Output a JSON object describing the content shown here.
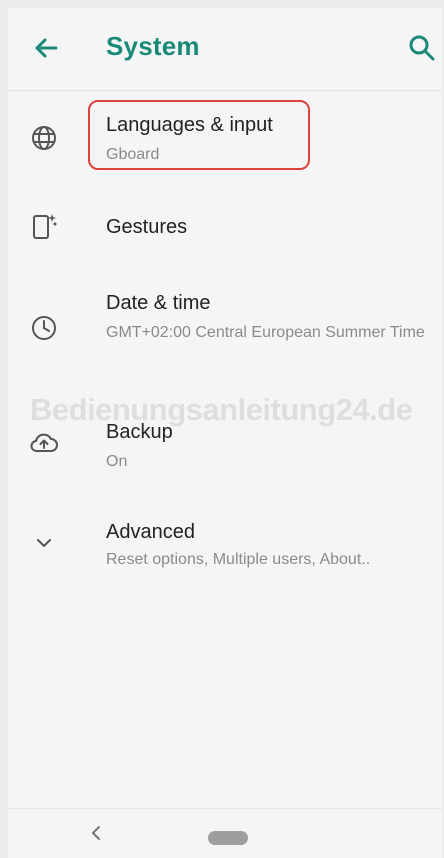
{
  "header": {
    "title": "System",
    "back_icon": "arrow-left-icon",
    "search_icon": "search-icon"
  },
  "items": [
    {
      "label": "Languages & input",
      "sub": "Gboard",
      "icon": "globe-icon",
      "highlighted": true
    },
    {
      "label": "Gestures",
      "sub": "",
      "icon": "phone-gesture-icon"
    },
    {
      "label": "Date & time",
      "sub": "GMT+02:00 Central European Summer Time",
      "icon": "clock-icon"
    },
    {
      "label": "Backup",
      "sub": "On",
      "icon": "cloud-upload-icon"
    },
    {
      "label": "Advanced",
      "sub": "Reset options, Multiple users, About..",
      "icon": "chevron-down-icon"
    }
  ],
  "watermark": "Bedienungsanleitung24.de",
  "navbar": {
    "back_icon": "nav-back-icon",
    "home_icon": "home-pill-icon"
  },
  "colors": {
    "accent": "#1a8a78",
    "highlight": "#e0423b"
  }
}
